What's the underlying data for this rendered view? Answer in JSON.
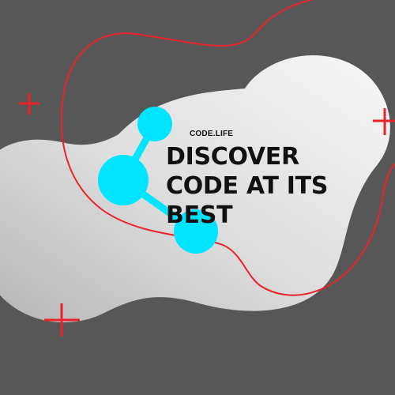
{
  "brand": {
    "name": "CODE.LIFE"
  },
  "headline": {
    "lines": [
      "DISCOVER",
      "CODE AT ITS",
      "BEST"
    ]
  },
  "colors": {
    "background": "#575757",
    "blob_light": "#f5f5f5",
    "blob_dark": "#bdbdbd",
    "accent_red": "#e8232a",
    "molecule": "#00e5ff",
    "text": "#111111"
  },
  "decorations": {
    "icons": [
      "plus-icon",
      "plus-icon",
      "plus-icon",
      "molecule-icon"
    ]
  }
}
